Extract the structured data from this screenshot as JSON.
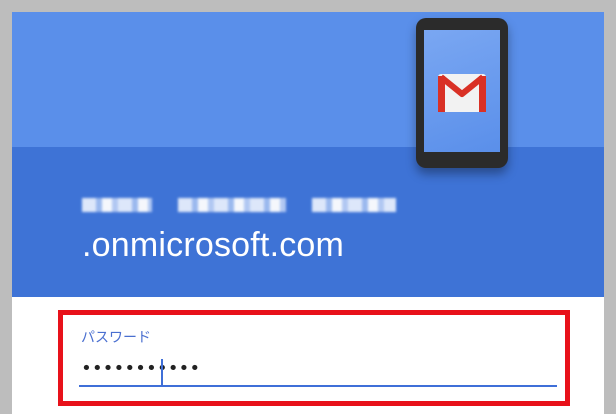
{
  "account": {
    "domain": ".onmicrosoft.com"
  },
  "password": {
    "label": "パスワード",
    "value": "•••••••••••"
  },
  "colors": {
    "header_light": "#5a8fea",
    "header_dark": "#3e73d6",
    "highlight": "#e8111a",
    "input_underline": "#3f6fd8"
  },
  "icons": [
    "gmail-logo-icon",
    "phone-illustration"
  ]
}
